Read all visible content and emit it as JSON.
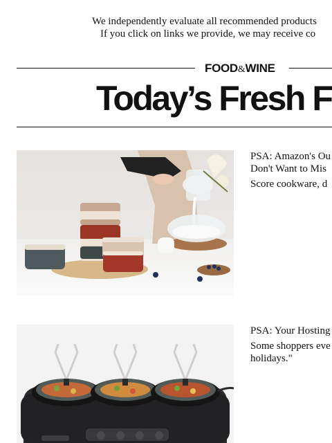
{
  "disclaimer": {
    "line1": "We independently evaluate all recommended products",
    "line2": "If you click on links we provide, we may receive co"
  },
  "brand": {
    "part1": "FOOD",
    "amp": "&",
    "part2": "WINE"
  },
  "hero": {
    "title": "Today’s Fresh Fi"
  },
  "articles": [
    {
      "title_line1": "PSA: Amazon's Ou",
      "title_line2": "Don't Want to Mis",
      "desc": "Score cookware, d"
    },
    {
      "title_line1": "PSA: Your Hosting",
      "desc_line1": "Some shoppers eve",
      "desc_line2": "holidays.\""
    }
  ]
}
